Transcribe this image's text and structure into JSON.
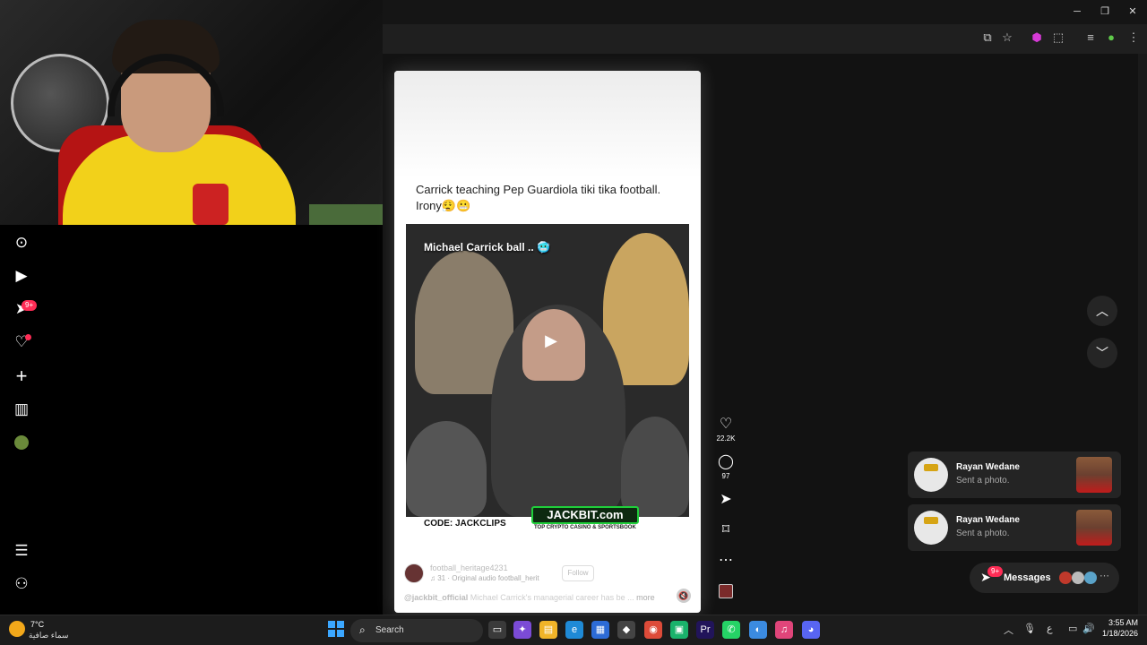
{
  "post": {
    "caption_line1": "Carrick teaching Pep Guardiola tiki tika football.",
    "caption_line2": "Irony😮‍💨😬",
    "video_title": "Michael Carrick ball .. 🥶",
    "sponsor_code": "CODE: JACKCLIPS",
    "sponsor_logo": "JACKBIT.com",
    "sponsor_sub": "TOP CRYPTO CASINO & SPORTSBOOK",
    "author": "football_heritage4231",
    "audio": "♫ 31 · Original audio  football_herit",
    "follow_label": "Follow",
    "description_user": "@jackbit_official",
    "description_text": " Michael Carrick's managerial career has be ...",
    "more_label": "more"
  },
  "actions": {
    "likes": "22.2K",
    "comments": "97"
  },
  "rail": {
    "inbox_badge": "9+"
  },
  "notifications": [
    {
      "name": "Rayan Wedane",
      "message": "Sent a photo."
    },
    {
      "name": "Rayan Wedane",
      "message": "Sent a photo."
    }
  ],
  "messages": {
    "label": "Messages",
    "badge": "9+"
  },
  "taskbar": {
    "weather_temp": "7°C",
    "weather_desc": "سماء صافية",
    "search_label": "Search",
    "time": "3:55 AM",
    "date": "1/18/2026",
    "lang": "ع"
  },
  "icons": {
    "explore": "compass-icon",
    "live": "play-icon",
    "inbox": "send-icon",
    "activity": "heart-icon",
    "upload": "plus-icon",
    "studio": "chart-icon"
  },
  "colors": {
    "accent": "#fe2c55",
    "stage_bg": "#121212",
    "jackbit_green": "#1fcf3a"
  }
}
